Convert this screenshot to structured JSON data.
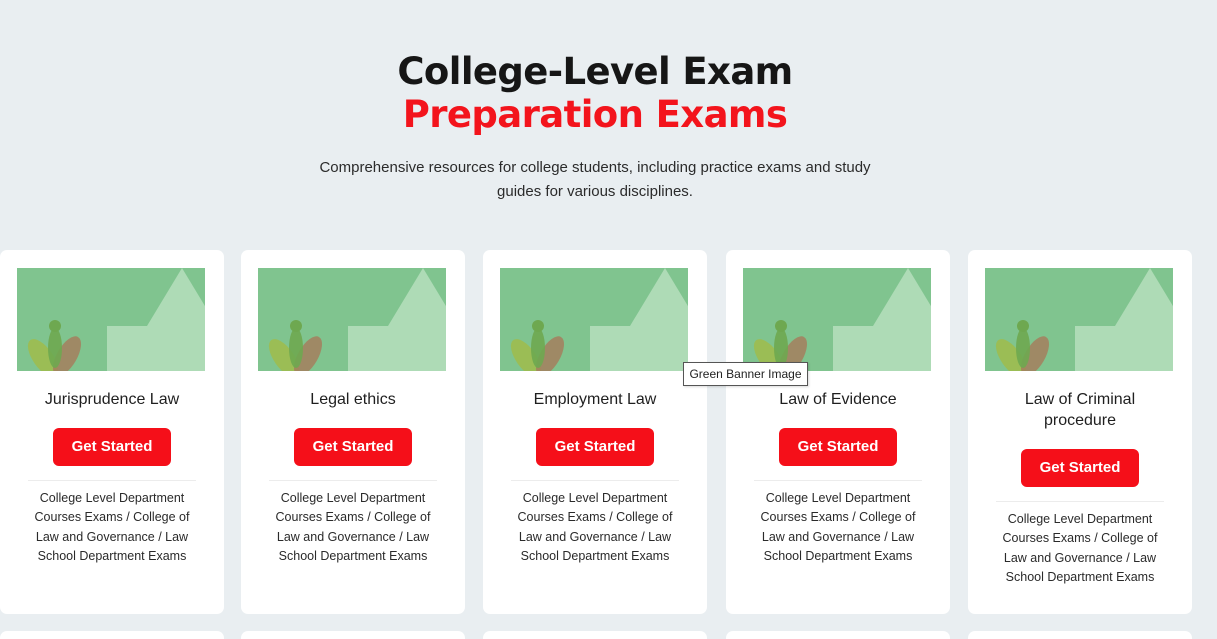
{
  "hero": {
    "title_main": "College-Level Exam ",
    "title_accent": "Preparation Exams",
    "subtitle": "Comprehensive resources for college students, including practice exams and study guides for various disciplines."
  },
  "cards": [
    {
      "title": "Jurisprudence Law",
      "button_label": "Get Started",
      "description": "College Level Department Courses Exams / College of Law and Governance / Law School Department Exams"
    },
    {
      "title": "Legal ethics",
      "button_label": "Get Started",
      "description": "College Level Department Courses Exams / College of Law and Governance / Law School Department Exams"
    },
    {
      "title": "Employment Law",
      "button_label": "Get Started",
      "description": "College Level Department Courses Exams / College of Law and Governance / Law School Department Exams"
    },
    {
      "title": "Law of Evidence",
      "button_label": "Get Started",
      "description": "College Level Department Courses Exams / College of Law and Governance / Law School Department Exams"
    },
    {
      "title": "Law of Criminal procedure",
      "button_label": "Get Started",
      "description": "College Level Department Courses Exams / College of Law and Governance / Law School Department Exams"
    }
  ],
  "tooltip": {
    "text": "Green Banner Image"
  },
  "colors": {
    "page_bg": "#e9eef1",
    "accent": "#f3141c",
    "button_bg": "#f50f19",
    "banner_green": "#80c48f"
  }
}
